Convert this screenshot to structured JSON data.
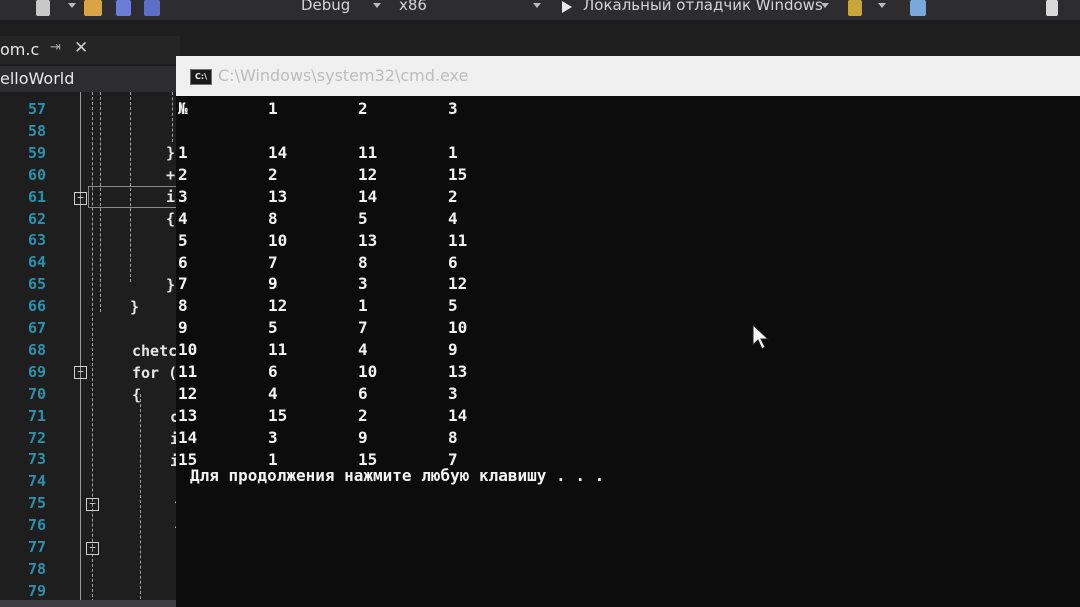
{
  "toolbar": {
    "config": "Debug",
    "platform": "x86",
    "debugger": "Локальный отладчик Windows"
  },
  "editor_tab": {
    "filename": "om.c",
    "project": "elloWorld"
  },
  "editor": {
    "line_numbers": [
      "57",
      "58",
      "59",
      "60",
      "61",
      "62",
      "63",
      "64",
      "65",
      "66",
      "67",
      "68",
      "69",
      "70",
      "71",
      "72",
      "73",
      "74",
      "75",
      "76",
      "77",
      "78",
      "79"
    ],
    "code_fragments": {
      "l59": "}",
      "l60": "+",
      "l61": "i",
      "l62": "{",
      "l65": "}",
      "l66": "}",
      "l68": "chetc",
      "l69": "for (",
      "l70": "{",
      "l71": "c",
      "l72": "i",
      "l73": "i",
      "l75": "f",
      "l76": "{"
    }
  },
  "console": {
    "title": "C:\\Windows\\system32\\cmd.exe",
    "header": [
      "№",
      "1",
      "2",
      "3"
    ],
    "rows": [
      [
        "1",
        "14",
        "11",
        "1"
      ],
      [
        "2",
        "2",
        "12",
        "15"
      ],
      [
        "3",
        "13",
        "14",
        "2"
      ],
      [
        "4",
        "8",
        "5",
        "4"
      ],
      [
        "5",
        "10",
        "13",
        "11"
      ],
      [
        "6",
        "7",
        "8",
        "6"
      ],
      [
        "7",
        "9",
        "3",
        "12"
      ],
      [
        "8",
        "12",
        "1",
        "5"
      ],
      [
        "9",
        "5",
        "7",
        "10"
      ],
      [
        "10",
        "11",
        "4",
        "9"
      ],
      [
        "11",
        "6",
        "10",
        "13"
      ],
      [
        "12",
        "4",
        "6",
        "3"
      ],
      [
        "13",
        "15",
        "2",
        "14"
      ],
      [
        "14",
        "3",
        "9",
        "8"
      ],
      [
        "15",
        "1",
        "15",
        "7"
      ]
    ],
    "prompt": "Для продолжения нажмите любую клавишу . . ."
  }
}
